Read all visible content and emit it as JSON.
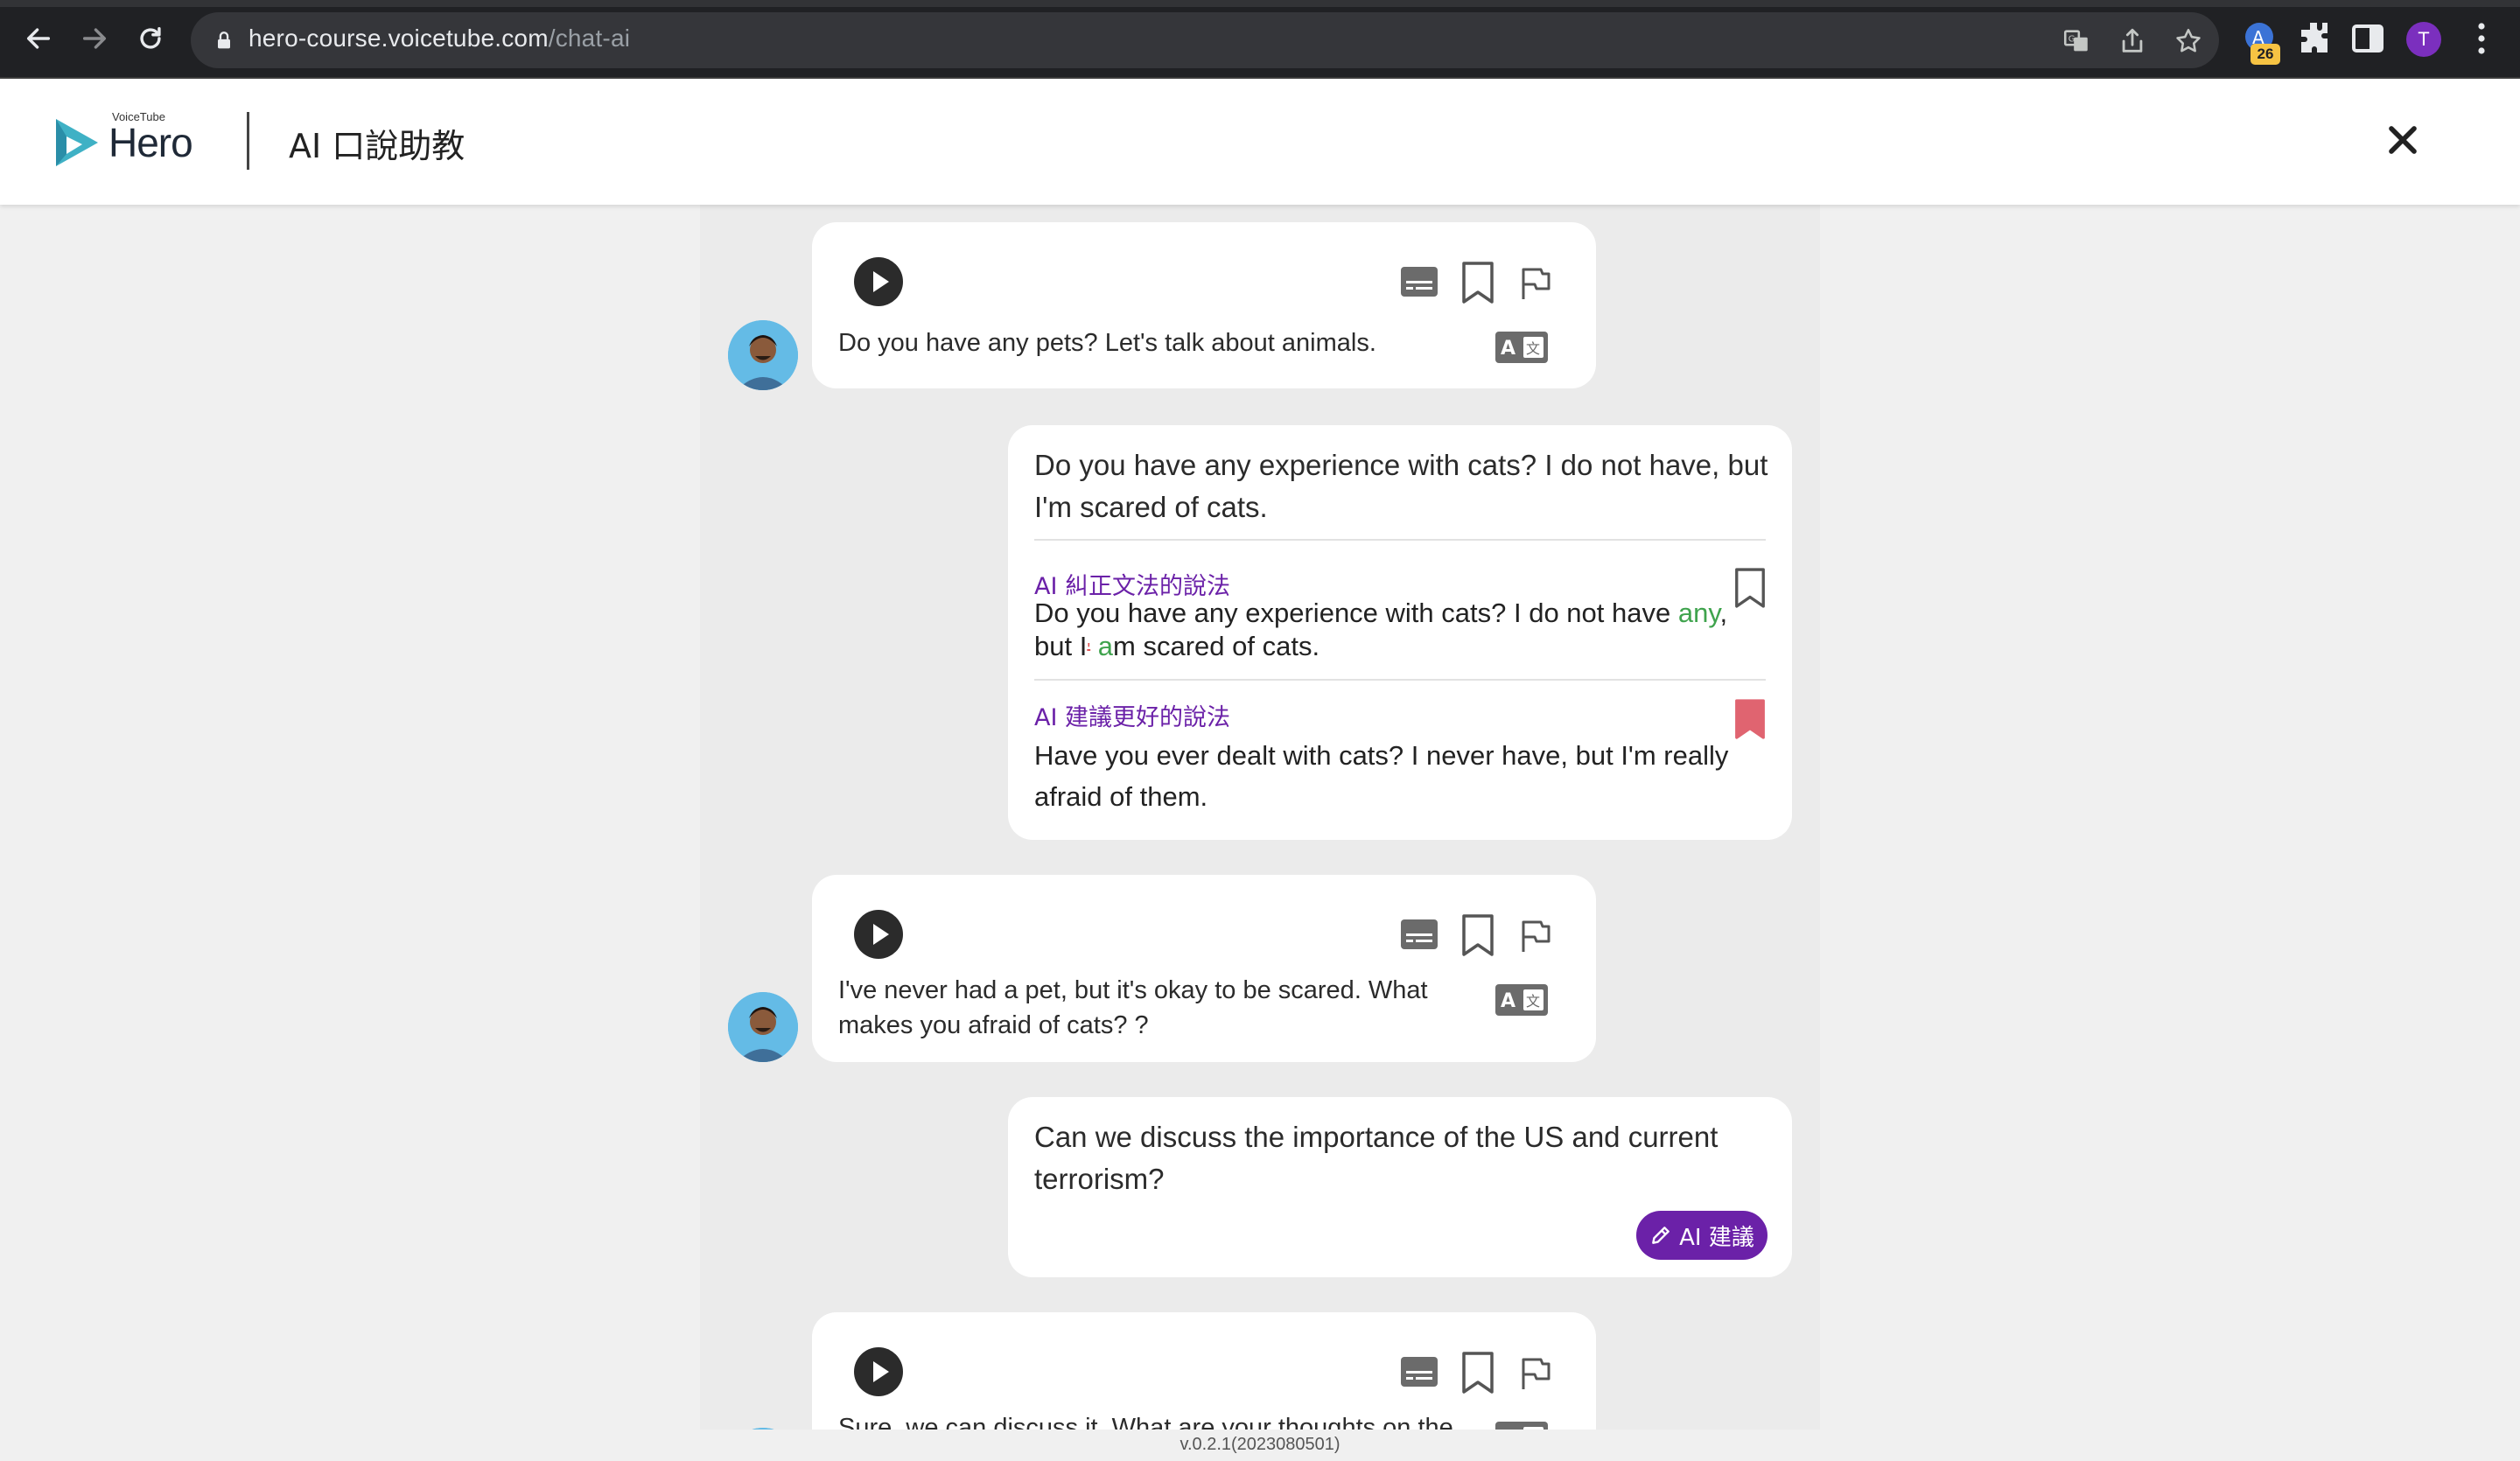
{
  "browser": {
    "url_host": "hero-course.voicetube.com",
    "url_path": "/chat-ai",
    "extension_badge": "26",
    "profile_initial": "T"
  },
  "header": {
    "logo_small": "VoiceTube",
    "logo_text": "Hero",
    "title": "AI 口說助教"
  },
  "messages": [
    {
      "role": "ai",
      "text": "Do you have any pets? Let's talk about animals."
    },
    {
      "role": "user",
      "text": "Do you have any experience with cats? I do not have, but I'm scared of cats.",
      "grammar_label": "AI 糾正文法的說法",
      "grammar_parts": [
        "Do you have any experience with cats? I do not have ",
        "any",
        ",",
        "but I",
        "'",
        " ",
        "a",
        "m scared of cats."
      ],
      "better_label": "AI 建議更好的說法",
      "better_text": "Have you ever dealt with cats? I never have, but I'm really afraid of them."
    },
    {
      "role": "ai",
      "text": "I've never had a pet, but it's okay to be scared. What makes you afraid of cats? ?"
    },
    {
      "role": "user",
      "text": "Can we discuss the importance of the US and current terrorism?",
      "suggest_button": "AI 建議"
    },
    {
      "role": "ai",
      "text": "Sure, we can discuss it. What are your thoughts on the"
    }
  ],
  "footer": {
    "version": "v.0.2.1(2023080501)"
  },
  "colors": {
    "accent_purple": "#6b21a8",
    "correction_green": "#3fa34d",
    "correction_red": "#e05252",
    "bookmark_active": "#e06470",
    "logo_teal": "#3fb1c5"
  }
}
